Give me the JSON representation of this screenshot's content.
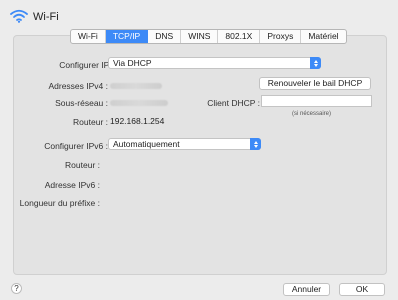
{
  "window": {
    "title": "Wi-Fi"
  },
  "tabs": [
    {
      "label": "Wi-Fi",
      "active": false
    },
    {
      "label": "TCP/IP",
      "active": true
    },
    {
      "label": "DNS",
      "active": false
    },
    {
      "label": "WINS",
      "active": false
    },
    {
      "label": "802.1X",
      "active": false
    },
    {
      "label": "Proxys",
      "active": false
    },
    {
      "label": "Matériel",
      "active": false
    }
  ],
  "ipv4": {
    "configure_label": "Configurer IPv4 :",
    "configure_value": "Via DHCP",
    "address_label": "Adresses IPv4 :",
    "subnet_label": "Sous-réseau :",
    "router_label": "Routeur :",
    "router_value": "192.168.1.254",
    "renew_button": "Renouveler le bail DHCP",
    "dhcp_client_label": "Client DHCP :",
    "dhcp_client_value": "",
    "dhcp_hint": "(si nécessaire)"
  },
  "ipv6": {
    "configure_label": "Configurer IPv6 :",
    "configure_value": "Automatiquement",
    "router_label": "Routeur :",
    "address_label": "Adresse IPv6 :",
    "prefix_label": "Longueur du préfixe :"
  },
  "footer": {
    "help": "?",
    "cancel_button": "Annuler",
    "ok_button": "OK"
  },
  "colors": {
    "accent": "#3d8af7",
    "background": "#ececec",
    "panel": "#e3e3e3"
  }
}
